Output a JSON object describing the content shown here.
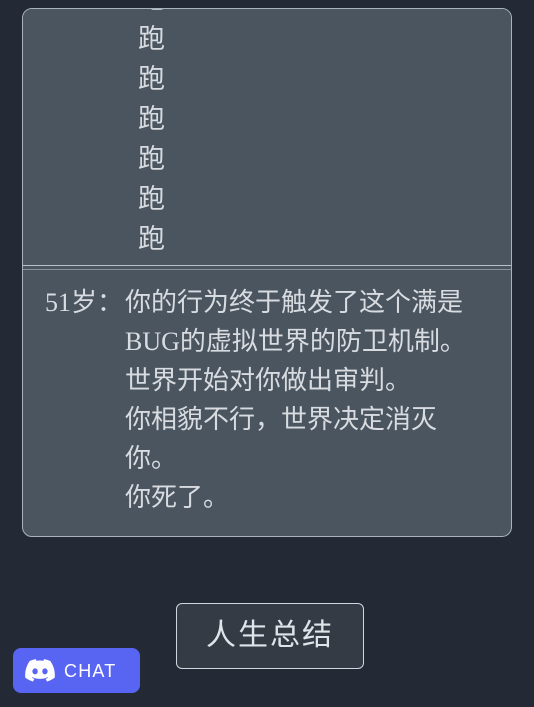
{
  "theme": {
    "page_background": "#232a35",
    "panel_background": "#4a5560",
    "panel_border": "#aab3bd",
    "text_color": "#d8dce0",
    "button_background": "#343b45",
    "button_border": "#cfd6dd",
    "discord_brand": "#5865f2"
  },
  "log": {
    "history_lines": [
      "跑",
      "跑",
      "跑",
      "跑",
      "跑",
      "跑",
      "跑"
    ],
    "divider": "log-divider",
    "latest_event": {
      "age_label": "51岁：",
      "lines": [
        "你的行为终于触发了这个满是",
        "BUG的虚拟世界的防卫机制。",
        "世界开始对你做出审判。",
        "你相貌不行，世界决定消灭",
        "你。",
        "你死了。"
      ]
    }
  },
  "actions": {
    "summary_button_label": "人生总结"
  },
  "chat_widget": {
    "label": "CHAT",
    "icon": "discord-icon"
  }
}
